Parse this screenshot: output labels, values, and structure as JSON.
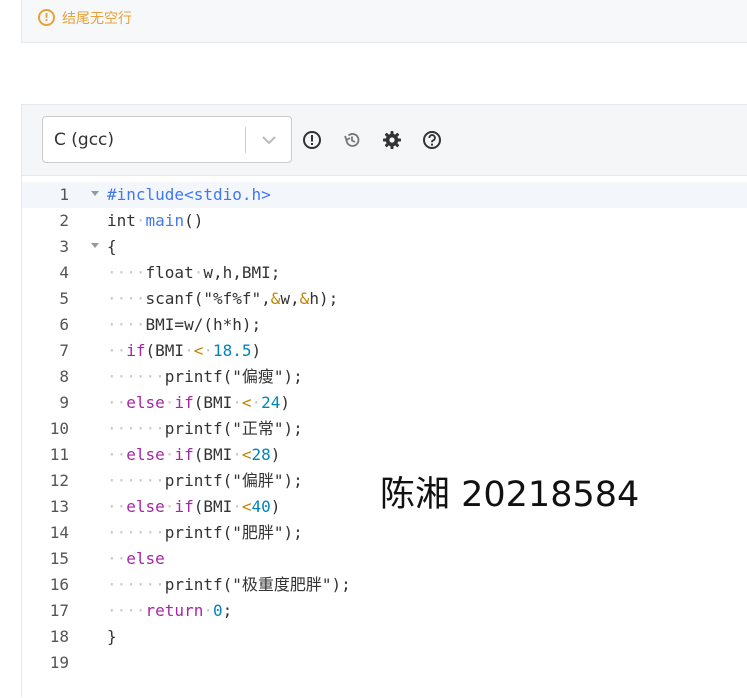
{
  "notice": {
    "icon": "alert-circle-icon",
    "text": "结尾无空行",
    "color": "#e6a23c"
  },
  "toolbar": {
    "language": "C (gcc)",
    "buttons": [
      {
        "name": "info-icon",
        "glyph": "!"
      },
      {
        "name": "history-icon"
      },
      {
        "name": "gear-icon"
      },
      {
        "name": "help-icon",
        "glyph": "?"
      }
    ]
  },
  "editor": {
    "lines": [
      {
        "n": "1",
        "fold": true,
        "tokens": [
          [
            "pp",
            "#include<stdio.h>"
          ]
        ]
      },
      {
        "n": "2",
        "tokens": [
          [
            "kw2",
            "int"
          ],
          [
            "dots",
            "·"
          ],
          [
            "fn",
            "main"
          ],
          [
            "",
            "()"
          ]
        ]
      },
      {
        "n": "3",
        "fold": true,
        "tokens": [
          [
            "",
            "{"
          ]
        ]
      },
      {
        "n": "4",
        "tokens": [
          [
            "dots",
            "····"
          ],
          [
            "",
            "float"
          ],
          [
            "dots",
            "·"
          ],
          [
            "",
            "w,h,BMI;"
          ]
        ]
      },
      {
        "n": "5",
        "tokens": [
          [
            "dots",
            "····"
          ],
          [
            "",
            "scanf(\"%f%f\","
          ],
          [
            "op",
            "&"
          ],
          [
            "",
            "w,"
          ],
          [
            "op",
            "&"
          ],
          [
            "",
            "h);"
          ]
        ]
      },
      {
        "n": "6",
        "tokens": [
          [
            "dots",
            "····"
          ],
          [
            "",
            "BMI=w/(h*h);"
          ]
        ]
      },
      {
        "n": "7",
        "tokens": [
          [
            "dots",
            "··"
          ],
          [
            "kw",
            "if"
          ],
          [
            "",
            "(BMI"
          ],
          [
            "dots",
            "·"
          ],
          [
            "op",
            "<"
          ],
          [
            "dots",
            "·"
          ],
          [
            "num",
            "18.5"
          ],
          [
            "",
            ")"
          ]
        ]
      },
      {
        "n": "8",
        "tokens": [
          [
            "dots",
            "······"
          ],
          [
            "",
            "printf(\"偏瘦\");"
          ]
        ]
      },
      {
        "n": "9",
        "tokens": [
          [
            "dots",
            "··"
          ],
          [
            "kw",
            "else"
          ],
          [
            "dots",
            "·"
          ],
          [
            "kw",
            "if"
          ],
          [
            "",
            "(BMI"
          ],
          [
            "dots",
            "·"
          ],
          [
            "op",
            "<"
          ],
          [
            "dots",
            "·"
          ],
          [
            "num",
            "24"
          ],
          [
            "",
            ")"
          ]
        ]
      },
      {
        "n": "10",
        "tokens": [
          [
            "dots",
            "······"
          ],
          [
            "",
            "printf(\"正常\");"
          ]
        ]
      },
      {
        "n": "11",
        "tokens": [
          [
            "dots",
            "··"
          ],
          [
            "kw",
            "else"
          ],
          [
            "dots",
            "·"
          ],
          [
            "kw",
            "if"
          ],
          [
            "",
            "(BMI"
          ],
          [
            "dots",
            "·"
          ],
          [
            "op",
            "<"
          ],
          [
            "num",
            "28"
          ],
          [
            "",
            ")"
          ]
        ]
      },
      {
        "n": "12",
        "tokens": [
          [
            "dots",
            "······"
          ],
          [
            "",
            "printf(\"偏胖\");"
          ]
        ]
      },
      {
        "n": "13",
        "tokens": [
          [
            "dots",
            "··"
          ],
          [
            "kw",
            "else"
          ],
          [
            "dots",
            "·"
          ],
          [
            "kw",
            "if"
          ],
          [
            "",
            "(BMI"
          ],
          [
            "dots",
            "·"
          ],
          [
            "op",
            "<"
          ],
          [
            "num",
            "40"
          ],
          [
            "",
            ")"
          ]
        ]
      },
      {
        "n": "14",
        "tokens": [
          [
            "dots",
            "······"
          ],
          [
            "",
            "printf(\"肥胖\");"
          ]
        ]
      },
      {
        "n": "15",
        "tokens": [
          [
            "dots",
            "··"
          ],
          [
            "kw",
            "else"
          ]
        ]
      },
      {
        "n": "16",
        "tokens": [
          [
            "dots",
            "······"
          ],
          [
            "",
            "printf(\"极重度肥胖\");"
          ]
        ]
      },
      {
        "n": "17",
        "tokens": [
          [
            "dots",
            "····"
          ],
          [
            "kw",
            "return"
          ],
          [
            "dots",
            "·"
          ],
          [
            "num",
            "0"
          ],
          [
            "",
            ";"
          ]
        ]
      },
      {
        "n": "18",
        "tokens": [
          [
            "",
            "}"
          ]
        ]
      },
      {
        "n": "19",
        "tokens": []
      }
    ]
  },
  "overlay_text": "陈湘 20218584"
}
